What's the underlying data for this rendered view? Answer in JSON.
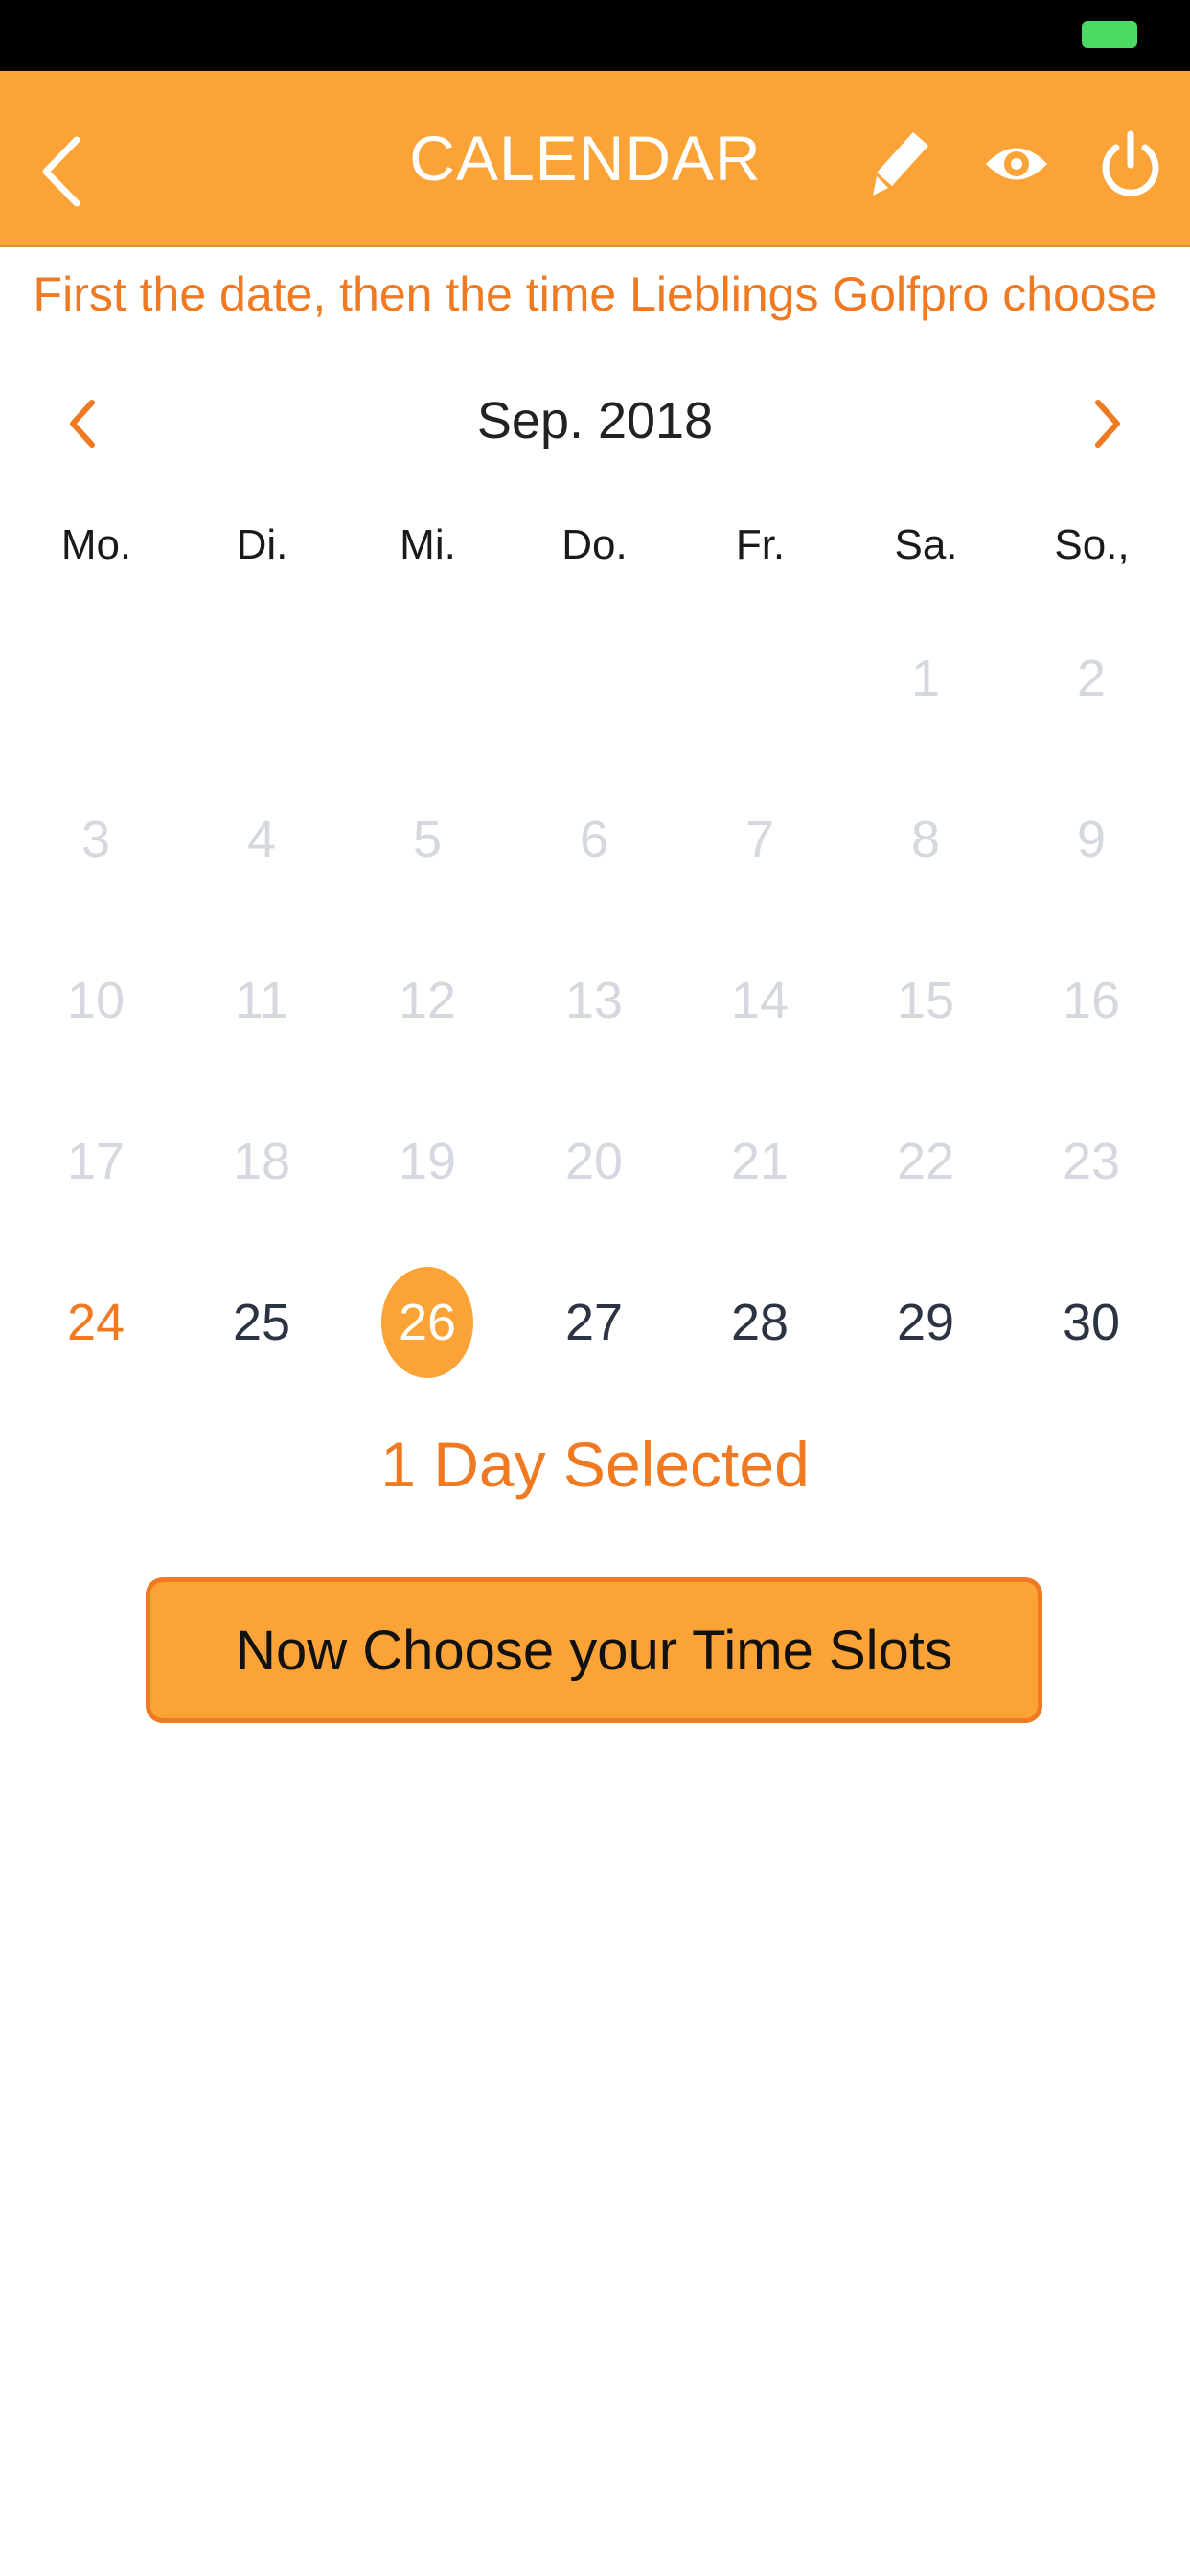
{
  "header": {
    "title": "CALENDAR",
    "icons": [
      "back-icon",
      "pencil-icon",
      "eye-icon",
      "power-icon"
    ]
  },
  "instruction": "First the date, then the time Lieblings Golfpro choose",
  "calendar": {
    "month_label": "Sep. 2018",
    "weekdays": [
      "Mo.",
      "Di.",
      "Mi.",
      "Do.",
      "Fr.",
      "Sa.",
      "So.,"
    ],
    "days": [
      {
        "label": "1",
        "state": "past"
      },
      {
        "label": "2",
        "state": "past"
      },
      {
        "label": "3",
        "state": "past"
      },
      {
        "label": "4",
        "state": "past"
      },
      {
        "label": "5",
        "state": "past"
      },
      {
        "label": "6",
        "state": "past"
      },
      {
        "label": "7",
        "state": "past"
      },
      {
        "label": "8",
        "state": "past"
      },
      {
        "label": "9",
        "state": "past"
      },
      {
        "label": "10",
        "state": "past"
      },
      {
        "label": "11",
        "state": "past"
      },
      {
        "label": "12",
        "state": "past"
      },
      {
        "label": "13",
        "state": "past"
      },
      {
        "label": "14",
        "state": "past"
      },
      {
        "label": "15",
        "state": "past"
      },
      {
        "label": "16",
        "state": "past"
      },
      {
        "label": "17",
        "state": "past"
      },
      {
        "label": "18",
        "state": "past"
      },
      {
        "label": "19",
        "state": "past"
      },
      {
        "label": "20",
        "state": "past"
      },
      {
        "label": "21",
        "state": "past"
      },
      {
        "label": "22",
        "state": "past"
      },
      {
        "label": "23",
        "state": "past"
      },
      {
        "label": "24",
        "state": "today"
      },
      {
        "label": "25",
        "state": "active"
      },
      {
        "label": "26",
        "state": "selected"
      },
      {
        "label": "27",
        "state": "active"
      },
      {
        "label": "28",
        "state": "active"
      },
      {
        "label": "29",
        "state": "active"
      },
      {
        "label": "30",
        "state": "active"
      }
    ]
  },
  "selection": {
    "count_label": "1 Day Selected"
  },
  "actions": {
    "time_slots_label": "Now Choose your Time Slots"
  },
  "colors": {
    "accent": "#fba336",
    "accent_dark": "#f07a22",
    "past_day": "#d5d8de",
    "active_day": "#2c3444"
  }
}
